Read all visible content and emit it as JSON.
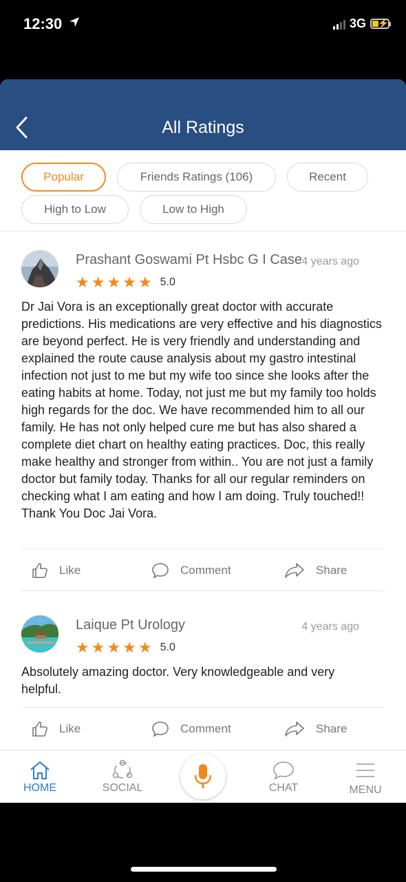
{
  "status_bar": {
    "time": "12:30",
    "network": "3G"
  },
  "header": {
    "title": "All Ratings"
  },
  "filters": [
    {
      "label": "Popular",
      "active": true
    },
    {
      "label": "Friends Ratings (106)",
      "active": false
    },
    {
      "label": "Recent",
      "active": false
    },
    {
      "label": "High to Low",
      "active": false
    },
    {
      "label": "Low to High",
      "active": false
    }
  ],
  "reviews": [
    {
      "name": "Prashant Goswami Pt Hsbc G I Case",
      "time": "4 years ago",
      "stars": 5,
      "rating": "5.0",
      "text": "Dr Jai Vora is an exceptionally great doctor with accurate predictions. His medications are very effective and his diagnostics are beyond perfect. He is very friendly and understanding and explained the route cause analysis about my gastro intestinal infection not just to me but my wife too since she looks after the eating habits at home. Today, not just me but my family too holds high regards for the doc. We have recommended him to all our family. He has not only helped cure me but has also shared a complete diet chart on healthy eating practices. Doc, this really make healthy and stronger from within.. You are not just a family doctor but family today. Thanks for all our regular reminders on checking what I am eating and how I am doing. Truly touched!! Thank You Doc Jai Vora."
    },
    {
      "name": "Laique Pt Urology",
      "time": "4 years ago",
      "stars": 5,
      "rating": "5.0",
      "text": "Absolutely amazing doctor. Very knowledgeable and very helpful."
    }
  ],
  "actions": {
    "like": "Like",
    "comment": "Comment",
    "share": "Share"
  },
  "bottom_nav": {
    "home": "HOME",
    "social": "SOCIAL",
    "chat": "CHAT",
    "menu": "MENU"
  },
  "colors": {
    "header_bg": "#284e82",
    "accent": "#f08a1c",
    "nav_active": "#2a7bd1"
  }
}
